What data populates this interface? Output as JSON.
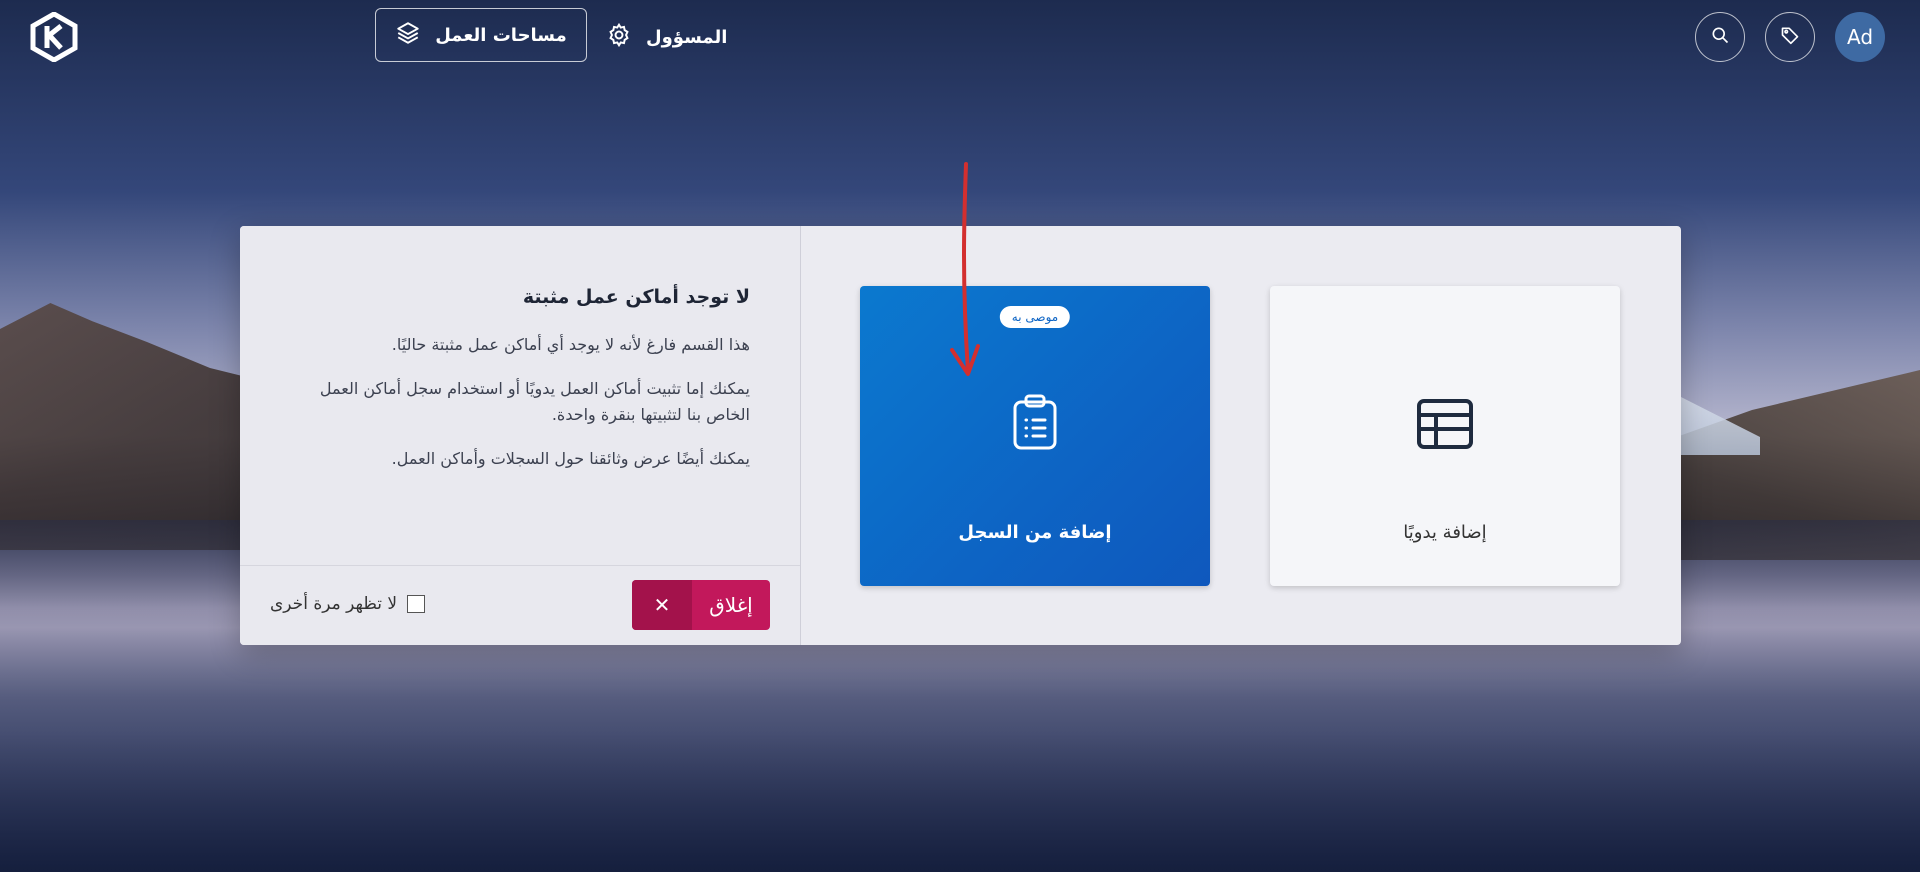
{
  "topbar": {
    "workspaces_label": "مساحات العمل",
    "admin_label": "المسؤول",
    "avatar_initials": "Ad"
  },
  "info": {
    "title": "لا توجد أماكن عمل مثبتة",
    "paragraphs": [
      "هذا القسم فارغ لأنه لا يوجد أي أماكن عمل مثبتة حاليًا.",
      "يمكنك إما تثبيت أماكن العمل يدويًا أو استخدام سجل أماكن العمل الخاص بنا لتثبيتها بنقرة واحدة.",
      "يمكنك أيضًا عرض وثائقنا حول السجلات وأماكن العمل."
    ],
    "close_label": "إغلاق",
    "dont_show_label": "لا تظهر مرة أخرى"
  },
  "cards": {
    "registry": {
      "label": "إضافة من السجل",
      "badge": "موصى به",
      "icon": "clipboard-list-icon"
    },
    "manual": {
      "label": "إضافة يدويًا",
      "icon": "table-icon"
    }
  },
  "colors": {
    "accent_blue": "#0d64c4",
    "close_button": "#c2185b",
    "annotation_arrow": "#d32f2f"
  }
}
